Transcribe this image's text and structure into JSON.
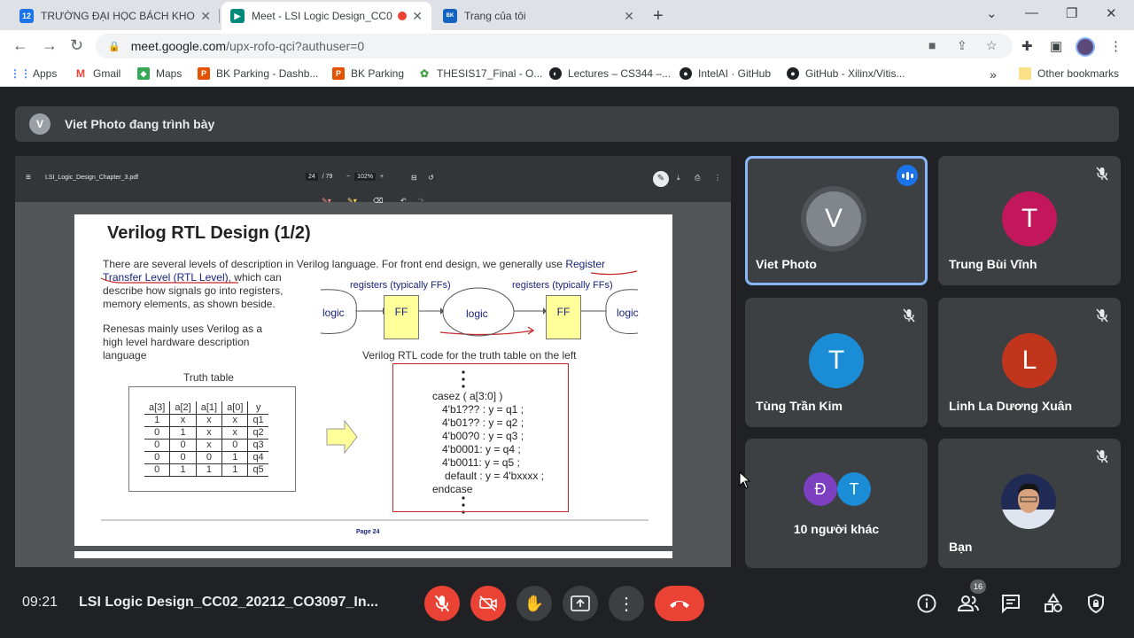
{
  "browser": {
    "tabs": [
      {
        "title": "TRƯỜNG ĐẠI HỌC BÁCH KHOA",
        "favicon_text": "12"
      },
      {
        "title": "Meet - LSI Logic Design_CC0"
      },
      {
        "title": "Trang của tôi",
        "favicon_text": "BK"
      }
    ],
    "url_main": "meet.google.com",
    "url_path": "/upx-rofo-qci?authuser=0",
    "bookmarks": [
      "Apps",
      "Gmail",
      "Maps",
      "BK Parking - Dashb...",
      "BK Parking",
      "THESIS17_Final - O...",
      "Lectures – CS344 –...",
      "IntelAI · GitHub",
      "GitHub - Xilinx/Vitis..."
    ],
    "other_bookmarks": "Other bookmarks",
    "more_bookmarks": "»"
  },
  "meet": {
    "presenter_initial": "V",
    "presenter_text": "Viet Photo đang trình bày",
    "time": "09:21",
    "meeting_name": "LSI Logic Design_CC02_20212_CO3097_In...",
    "participant_count": "16",
    "participants": [
      {
        "name": "Viet Photo",
        "initial": "V",
        "color": "#80868b"
      },
      {
        "name": "Trung Bùi Vĩnh",
        "initial": "T",
        "color": "#c2185b"
      },
      {
        "name": "Tùng Trần Kim",
        "initial": "T",
        "color": "#1a8dd6"
      },
      {
        "name": "Linh La Dương Xuân",
        "initial": "L",
        "color": "#c1351d"
      },
      {
        "name": "Bạn"
      }
    ],
    "others": {
      "label": "10 người khác",
      "initials": [
        "Đ",
        "T"
      ]
    }
  },
  "pdf": {
    "filename": "LSI_Logic_Design_Chapter_3.pdf",
    "page": "24",
    "pages": "/ 79",
    "zoom": "102%",
    "slide": {
      "title": "Verilog RTL Design  (1/2)",
      "intro_1": "There are several levels of description in Verilog language. For front end design, we generally use ",
      "intro_reg": "Register",
      "intro_2": "Transfer Level (RTL Level)",
      "intro_3": ", which can",
      "intro_4": "describe how signals go into registers,",
      "intro_5": "memory elements, as shown beside.",
      "renesas_1": "Renesas mainly uses Verilog as a",
      "renesas_2": "high level hardware description",
      "renesas_3": "language",
      "registers_label": "registers (typically FFs)",
      "logic": "logic",
      "ff": "FF",
      "verilog_caption": "Verilog RTL code for the truth table on the left",
      "truth_table_title": "Truth table",
      "truth_table_header": [
        "a[3]",
        "a[2]",
        "a[1]",
        "a[0]",
        "y"
      ],
      "truth_table_rows": [
        [
          "1",
          "x",
          "x",
          "x",
          "q1"
        ],
        [
          "0",
          "1",
          "x",
          "x",
          "q2"
        ],
        [
          "0",
          "0",
          "x",
          "0",
          "q3"
        ],
        [
          "0",
          "0",
          "0",
          "1",
          "q4"
        ],
        [
          "0",
          "1",
          "1",
          "1",
          "q5"
        ]
      ],
      "code_lines": [
        "casez ( a[3:0] )",
        "4'b1??? : y = q1 ;",
        "4'b01?? : y = q2 ;",
        "4'b00?0 : y = q3 ;",
        "4'b0001:  y = q4 ;",
        "4'b0011:  y = q5 ;",
        "default :  y = 4'bxxxx ;",
        "endcase"
      ],
      "page_label": "Page 24"
    }
  },
  "colors": {
    "accent": "#1a73e8",
    "red": "#ea4335",
    "tile_bg": "#3c4043"
  }
}
